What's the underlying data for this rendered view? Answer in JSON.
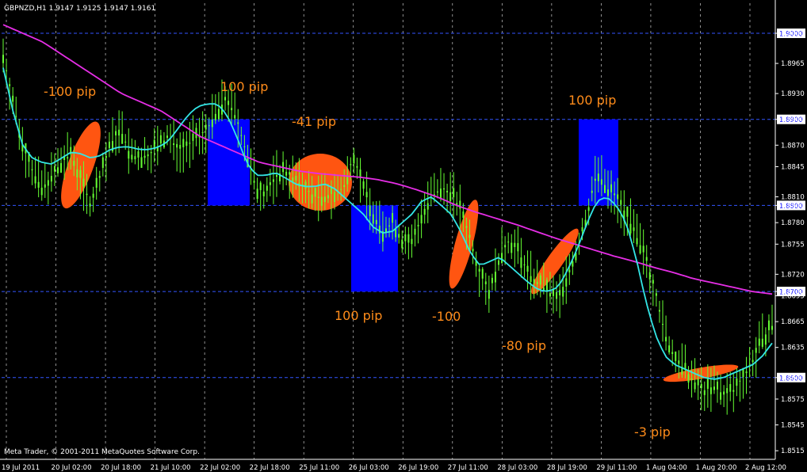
{
  "window": {
    "symbol_header": "GBPNZD,H1  1.9147 1.9125 1.9147 1.9161",
    "footer": "Meta Trader, © 2001-2011 MetaQuotes Software Corp."
  },
  "colors": {
    "background": "#000000",
    "grid": "#ffffff",
    "candles": "#66ff33",
    "ma_fast": "#33e6e6",
    "ma_slow": "#e62ee6",
    "annotation_text": "#ff8c1a",
    "ellipse": "#ff5511",
    "box": "#0000ff",
    "hline": "#3355ff",
    "price_tag_bg": "#ffffff",
    "price_tag_text": "#0000ff",
    "axis_text": "#ffffff"
  },
  "chart_data": {
    "type": "line",
    "title": "GBPNZD,H1",
    "ohlc_header": "1.9147 1.9125 1.9147 1.9161",
    "ylim": [
      1.8505,
      1.9035
    ],
    "y_ticks": [
      "1.9000",
      "1.8965",
      "1.8930",
      "1.8900",
      "1.8870",
      "1.8845",
      "1.8810",
      "1.8800",
      "1.8780",
      "1.8755",
      "1.8720",
      "1.8700",
      "1.8695",
      "1.8665",
      "1.8635",
      "1.8600",
      "1.8575",
      "1.8545",
      "1.8515"
    ],
    "x_ticks": [
      "19 Jul 2011",
      "20 Jul 02:00",
      "20 Jul 18:00",
      "21 Jul 10:00",
      "22 Jul 02:00",
      "22 Jul 18:00",
      "25 Jul 11:00",
      "26 Jul 03:00",
      "26 Jul 19:00",
      "27 Jul 11:00",
      "28 Jul 03:00",
      "28 Jul 19:00",
      "29 Jul 11:00",
      "1 Aug 04:00",
      "1 Aug 20:00",
      "2 Aug 12:00"
    ],
    "price_labels": [
      "1.9000",
      "1.8900",
      "1.8800",
      "1.8700",
      "1.8600"
    ],
    "series": [
      {
        "name": "price",
        "values": [
          1.8975,
          1.892,
          1.887,
          1.884,
          1.882,
          1.8835,
          1.885,
          1.886,
          1.883,
          1.88,
          1.8835,
          1.887,
          1.889,
          1.886,
          1.8855,
          1.886,
          1.887,
          1.888,
          1.8865,
          1.887,
          1.888,
          1.889,
          1.891,
          1.8925,
          1.89,
          1.886,
          1.882,
          1.8815,
          1.8835,
          1.884,
          1.883,
          1.882,
          1.881,
          1.881,
          1.8815,
          1.882,
          1.886,
          1.882,
          1.879,
          1.877,
          1.878,
          1.876,
          1.8755,
          1.879,
          1.881,
          1.882,
          1.8815,
          1.8795,
          1.876,
          1.872,
          1.87,
          1.874,
          1.876,
          1.8745,
          1.872,
          1.871,
          1.87,
          1.869,
          1.872,
          1.875,
          1.879,
          1.884,
          1.882,
          1.881,
          1.879,
          1.8765,
          1.874,
          1.87,
          1.865,
          1.862,
          1.861,
          1.8595,
          1.8585,
          1.859,
          1.858,
          1.8585,
          1.86,
          1.862,
          1.8645,
          1.866
        ]
      },
      {
        "name": "ma_fast",
        "values": [
          1.896,
          1.891,
          1.887,
          1.8855,
          1.885,
          1.8848,
          1.8855,
          1.8862,
          1.886,
          1.8855,
          1.8858,
          1.8865,
          1.8868,
          1.8868,
          1.8865,
          1.8865,
          1.8868,
          1.8875,
          1.889,
          1.8905,
          1.8915,
          1.8918,
          1.8918,
          1.8905,
          1.888,
          1.885,
          1.8835,
          1.8835,
          1.8838,
          1.8832,
          1.8825,
          1.8822,
          1.8822,
          1.8825,
          1.882,
          1.881,
          1.88,
          1.879,
          1.8775,
          1.8768,
          1.877,
          1.878,
          1.879,
          1.8805,
          1.881,
          1.88,
          1.879,
          1.877,
          1.8745,
          1.873,
          1.8735,
          1.874,
          1.873,
          1.872,
          1.871,
          1.8702,
          1.87,
          1.8705,
          1.8725,
          1.875,
          1.878,
          1.8805,
          1.881,
          1.88,
          1.878,
          1.874,
          1.869,
          1.865,
          1.8625,
          1.8615,
          1.861,
          1.8605,
          1.86,
          1.8598,
          1.86,
          1.8605,
          1.861,
          1.8615,
          1.8625,
          1.864
        ]
      },
      {
        "name": "ma_slow",
        "values": [
          1.901,
          1.9,
          1.899,
          1.8975,
          1.896,
          1.8945,
          1.893,
          1.892,
          1.891,
          1.8895,
          1.888,
          1.887,
          1.886,
          1.885,
          1.8845,
          1.884,
          1.8837,
          1.8835,
          1.8833,
          1.883,
          1.8825,
          1.8818,
          1.881,
          1.88,
          1.8792,
          1.8785,
          1.8778,
          1.877,
          1.8762,
          1.8755,
          1.8748,
          1.8741,
          1.8735,
          1.8728,
          1.8722,
          1.8715,
          1.871,
          1.8705,
          1.87,
          1.8697
        ]
      }
    ],
    "annotations": [
      "-100 pip",
      "100 pip",
      "-41 pip",
      "100 pip",
      "-100",
      "-80 pip",
      "100 pip",
      "-3 pip"
    ]
  }
}
